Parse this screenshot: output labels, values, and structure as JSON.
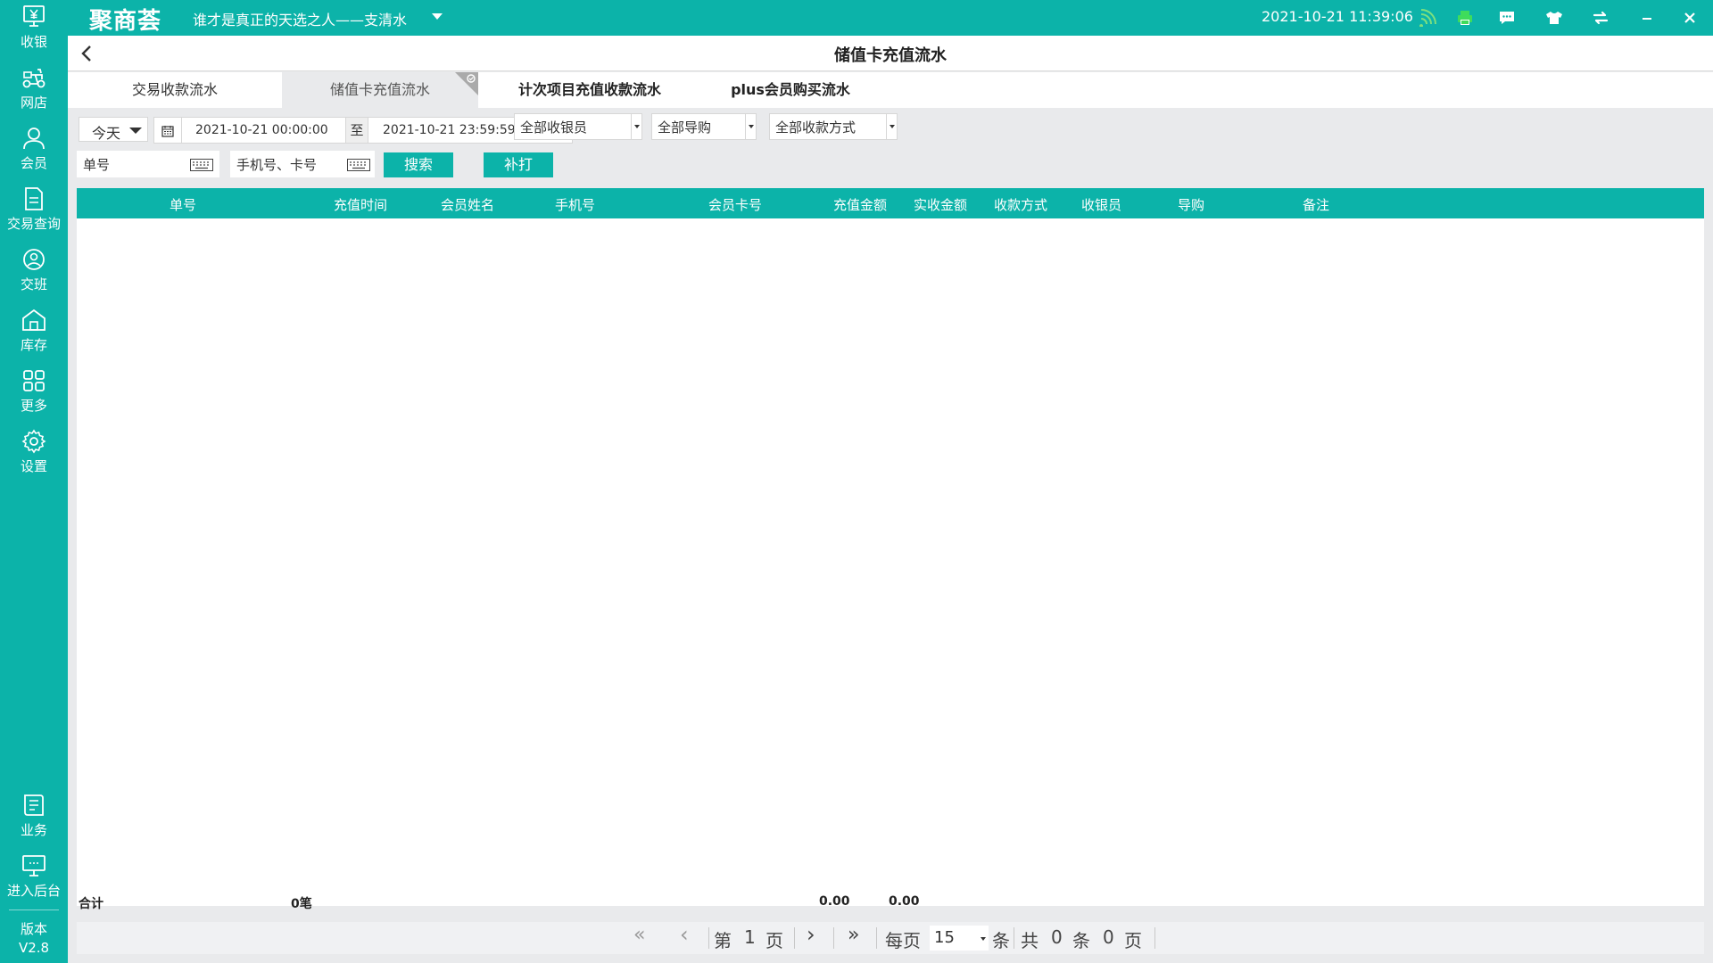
{
  "app": {
    "logo": "聚商荟",
    "store_name": "谁才是真正的天选之人——支清水",
    "datetime": "2021-10-21 11:39:06"
  },
  "sidebar": {
    "items": [
      {
        "label": "收银",
        "icon": "cashier-icon"
      },
      {
        "label": "网店",
        "icon": "scooter-icon"
      },
      {
        "label": "会员",
        "icon": "member-icon"
      },
      {
        "label": "交易查询",
        "icon": "document-icon"
      },
      {
        "label": "交班",
        "icon": "shift-icon"
      },
      {
        "label": "库存",
        "icon": "warehouse-icon"
      },
      {
        "label": "更多",
        "icon": "grid-icon"
      },
      {
        "label": "设置",
        "icon": "gear-icon"
      },
      {
        "label": "业务",
        "icon": "business-icon"
      },
      {
        "label": "进入后台",
        "icon": "monitor-icon"
      }
    ],
    "version_label": "版本",
    "version": "V2.8"
  },
  "page": {
    "title": "储值卡充值流水"
  },
  "tabs": [
    {
      "label": "交易收款流水"
    },
    {
      "label": "储值卡充值流水"
    },
    {
      "label": "计次项目充值收款流水"
    },
    {
      "label": "plus会员购买流水"
    }
  ],
  "filters": {
    "period": "今天",
    "start_date": "2021-10-21 00:00:00",
    "to_label": "至",
    "end_date": "2021-10-21 23:59:59",
    "cashier": "全部收银员",
    "guide": "全部导购",
    "payment": "全部收款方式",
    "order_placeholder": "单号",
    "phone_placeholder": "手机号、卡号",
    "search_label": "搜索",
    "reprint_label": "补打"
  },
  "table": {
    "columns": [
      "单号",
      "充值时间",
      "会员姓名",
      "手机号",
      "会员卡号",
      "充值金额",
      "实收金额",
      "收款方式",
      "收银员",
      "导购",
      "备注"
    ],
    "rows": []
  },
  "summary": {
    "label": "合计",
    "count": "0笔",
    "recharge_total": "0.00",
    "received_total": "0.00"
  },
  "pager": {
    "first": "«",
    "prev": "‹",
    "page_prefix": "第",
    "page": "1",
    "page_suffix": "页",
    "next": "›",
    "last": "»",
    "per_page_label": "每页",
    "per_page": "15",
    "per_page_unit": "条",
    "total_prefix": "共",
    "total_items": "0",
    "total_items_unit": "条",
    "total_pages": "0",
    "total_pages_unit": "页"
  },
  "colors": {
    "accent": "#0cb3a9",
    "wifi": "#7ee07e",
    "printer": "#3fdc5b"
  }
}
